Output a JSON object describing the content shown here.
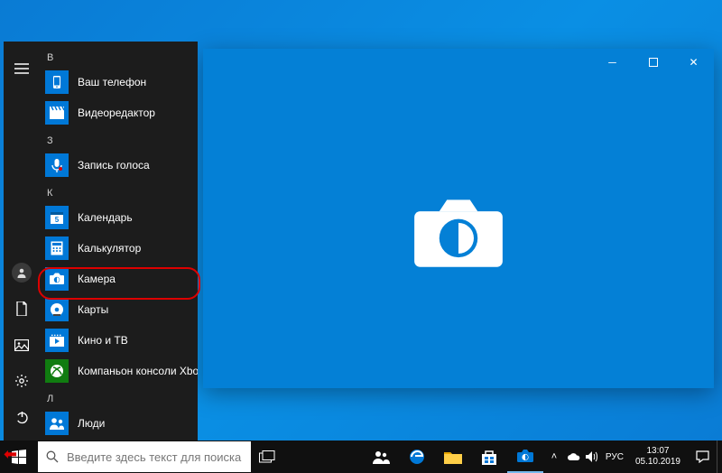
{
  "start_menu": {
    "sections": [
      {
        "letter": "В",
        "items": [
          {
            "key": "phone",
            "label": "Ваш телефон",
            "icon": "phone-icon",
            "color": "blue"
          },
          {
            "key": "video",
            "label": "Видеоредактор",
            "icon": "clapper-icon",
            "color": "blue"
          }
        ]
      },
      {
        "letter": "З",
        "items": [
          {
            "key": "voice",
            "label": "Запись голоса",
            "icon": "mic-icon",
            "color": "blue"
          }
        ]
      },
      {
        "letter": "К",
        "items": [
          {
            "key": "calendar",
            "label": "Календарь",
            "icon": "calendar-icon",
            "color": "blue"
          },
          {
            "key": "calc",
            "label": "Калькулятор",
            "icon": "calc-icon",
            "color": "blue"
          },
          {
            "key": "camera",
            "label": "Камера",
            "icon": "camera-icon",
            "color": "blue"
          },
          {
            "key": "maps",
            "label": "Карты",
            "icon": "maps-icon",
            "color": "blue"
          },
          {
            "key": "movies",
            "label": "Кино и ТВ",
            "icon": "movies-icon",
            "color": "blue"
          },
          {
            "key": "xbox",
            "label": "Компаньон консоли Xbox",
            "icon": "xbox-icon",
            "color": "green"
          }
        ]
      },
      {
        "letter": "Л",
        "items": [
          {
            "key": "people",
            "label": "Люди",
            "icon": "people-icon",
            "color": "blue"
          }
        ]
      }
    ]
  },
  "camera_window": {
    "min": "–",
    "max": "▢",
    "close": "✕"
  },
  "taskbar": {
    "search_placeholder": "Введите здесь текст для поиска",
    "lang": "РУС",
    "time": "13:07",
    "date": "05.10.2019"
  }
}
